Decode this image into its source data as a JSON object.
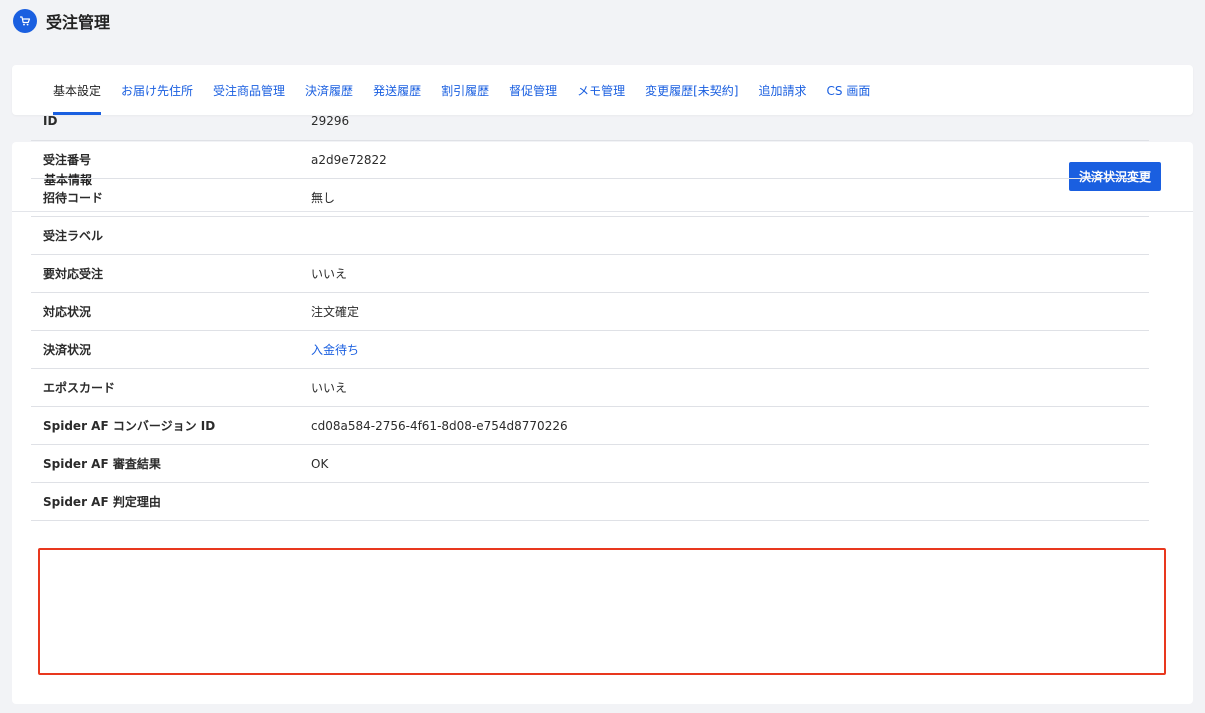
{
  "header": {
    "title": "受注管理",
    "icon": "order-cart-icon",
    "accent_color": "#1a5fe0"
  },
  "tabs": [
    {
      "label": "基本設定",
      "active": true
    },
    {
      "label": "お届け先住所",
      "active": false
    },
    {
      "label": "受注商品管理",
      "active": false
    },
    {
      "label": "決済履歴",
      "active": false
    },
    {
      "label": "発送履歴",
      "active": false
    },
    {
      "label": "割引履歴",
      "active": false
    },
    {
      "label": "督促管理",
      "active": false
    },
    {
      "label": "メモ管理",
      "active": false
    },
    {
      "label": "変更履歴[未契約]",
      "active": false
    },
    {
      "label": "追加請求",
      "active": false
    },
    {
      "label": "CS 画面",
      "active": false
    }
  ],
  "section": {
    "title": "基本情報",
    "action_label": "決済状況変更"
  },
  "rows": [
    {
      "label": "ID",
      "value": "29296"
    },
    {
      "label": "受注番号",
      "value": "a2d9e72822"
    },
    {
      "label": "招待コード",
      "value": "無し"
    },
    {
      "label": "受注ラベル",
      "value": ""
    },
    {
      "label": "要対応受注",
      "value": "いいえ"
    },
    {
      "label": "対応状況",
      "value": "注文確定"
    },
    {
      "label": "決済状況",
      "value": "入金待ち",
      "link": true
    },
    {
      "label": "エポスカード",
      "value": "いいえ"
    },
    {
      "label": "Spider AF コンバージョン ID",
      "value": "cd08a584-2756-4f61-8d08-e754d8770226"
    },
    {
      "label": "Spider AF 審査結果",
      "value": "OK"
    },
    {
      "label": "Spider AF 判定理由",
      "value": ""
    }
  ],
  "highlight_color": "#e8381e"
}
